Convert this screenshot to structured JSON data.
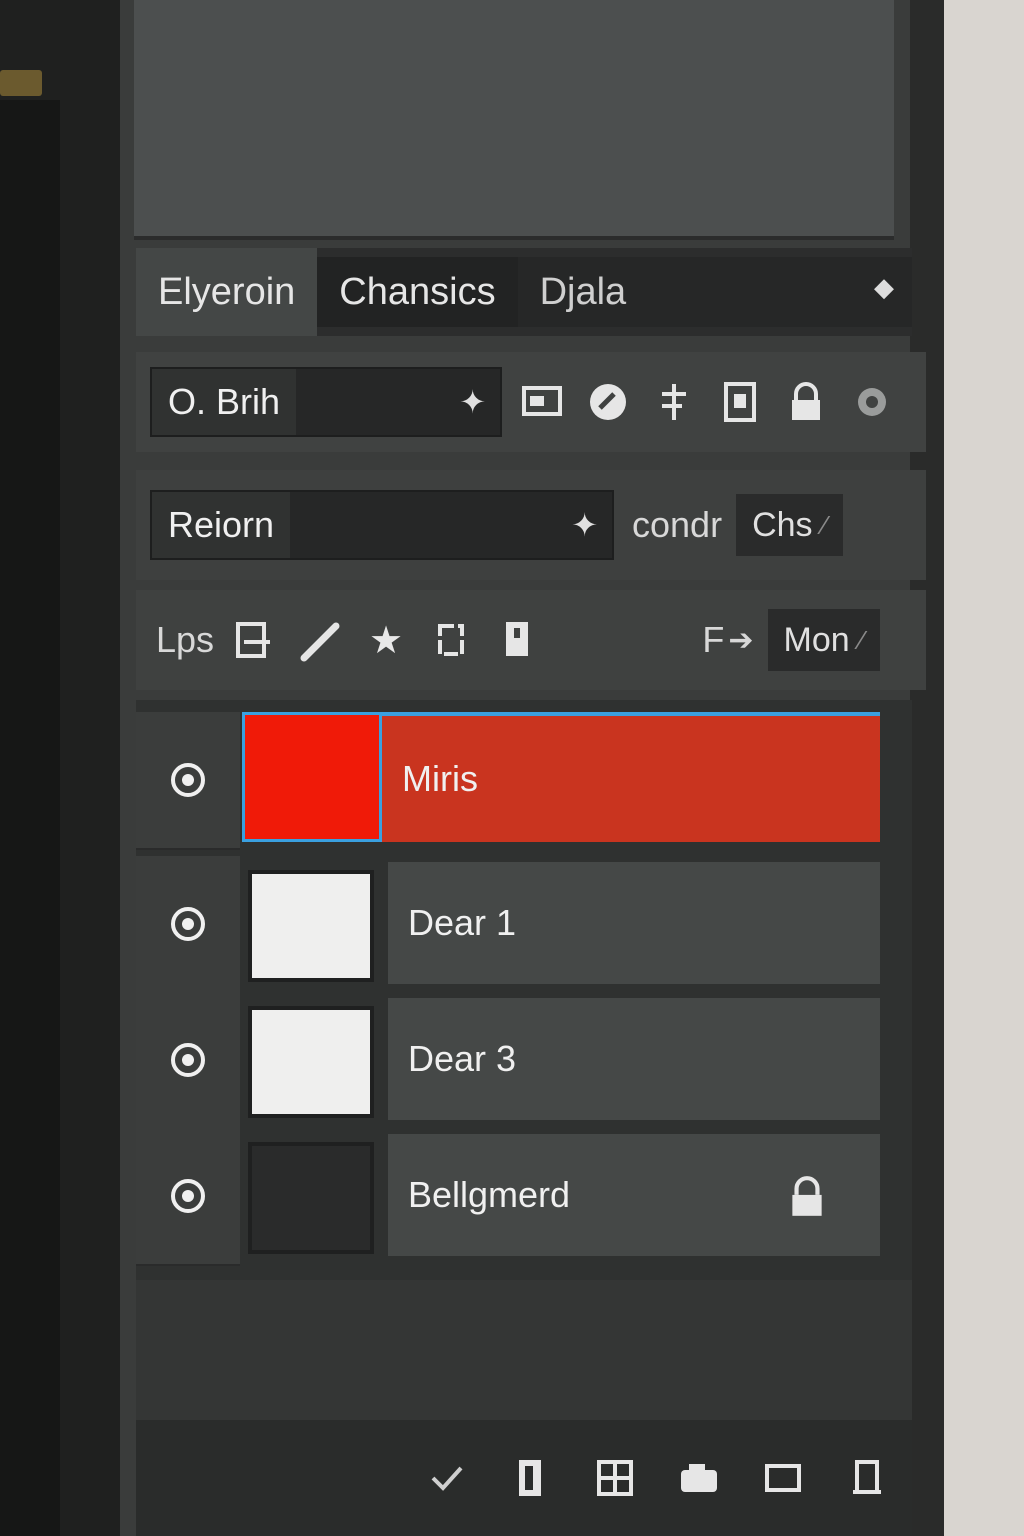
{
  "tabs": [
    {
      "label": "Elyeroin"
    },
    {
      "label": "Chansics"
    },
    {
      "label": "Djala"
    }
  ],
  "blend_mode": {
    "value": "O. Brih"
  },
  "row1_icons": [
    "image-icon",
    "pin-icon",
    "adjust-icon",
    "frame-icon",
    "lock-icon",
    "settings-icon"
  ],
  "reference": {
    "value": "Reiorn",
    "label": "condr",
    "chip": "Chs"
  },
  "locks": {
    "label": "Lps",
    "chip_label": "F",
    "chip": "Mon"
  },
  "layers": [
    {
      "name": "Miris",
      "selected": true,
      "thumb_color": "#f01a08",
      "locked": false
    },
    {
      "name": "Dear 1",
      "selected": false,
      "thumb_color": "#efefee",
      "locked": false
    },
    {
      "name": "Dear 3",
      "selected": false,
      "thumb_color": "#efefee",
      "locked": false
    },
    {
      "name": "Bellgmerd",
      "selected": false,
      "thumb_color": "#2a2b2b",
      "locked": true
    }
  ],
  "bottom_icons": [
    "link-icon",
    "fx-icon",
    "mask-icon",
    "group-icon",
    "new-layer-icon",
    "delete-icon"
  ],
  "colors": {
    "selection_accent": "#3aa0e0",
    "selected_layer": "#c9341f"
  }
}
